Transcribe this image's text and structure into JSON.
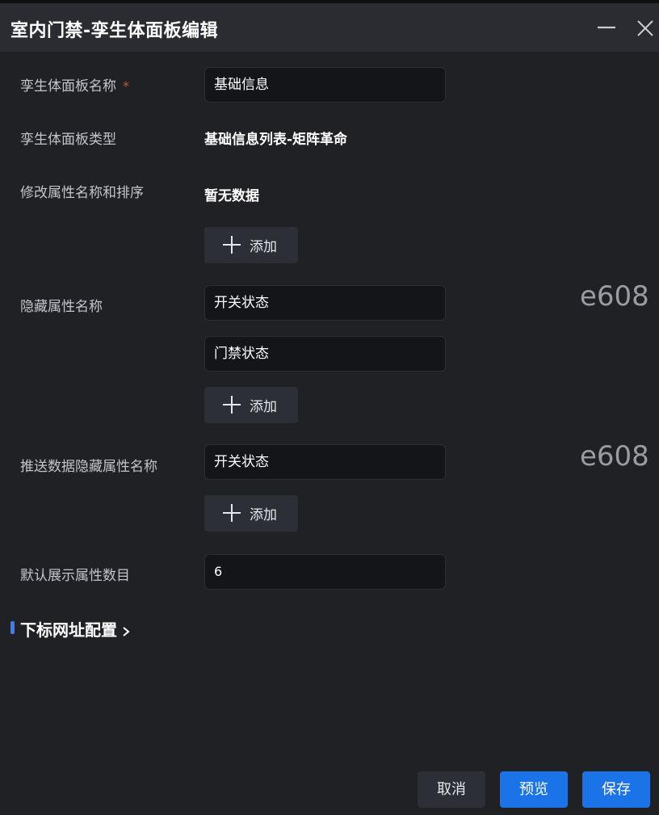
{
  "dialog": {
    "title": "室内门禁-孪生体面板编辑"
  },
  "form": {
    "name": {
      "label": "孪生体面板名称",
      "required_mark": "*",
      "value": "基础信息"
    },
    "type": {
      "label": "孪生体面板类型",
      "value": "基础信息列表-矩阵革命"
    },
    "rename_sort": {
      "label": "修改属性名称和排序",
      "value": "暂无数据",
      "add_label": "添加"
    },
    "hidden_attrs": {
      "label": "隐藏属性名称",
      "values": [
        "开关状态",
        "门禁状态"
      ],
      "add_label": "添加",
      "watermark": "e608"
    },
    "push_hidden_attrs": {
      "label": "推送数据隐藏属性名称",
      "values": [
        "开关状态"
      ],
      "add_label": "添加",
      "watermark": "e608"
    },
    "default_count": {
      "label": "默认展示属性数目",
      "value": "6"
    }
  },
  "section": {
    "title": "下标网址配置"
  },
  "footer": {
    "cancel": "取消",
    "preview": "预览",
    "save": "保存"
  },
  "colors": {
    "background": "#202125",
    "header": "#2a2c31",
    "input_bg": "#141519",
    "primary": "#1b73e8",
    "accent_bar": "#3a7cf5",
    "required": "#c0563f"
  },
  "icons": {
    "minimize": "minimize-icon",
    "close": "close-icon",
    "add": "plus-icon",
    "expand": "chevron-right-icon"
  }
}
